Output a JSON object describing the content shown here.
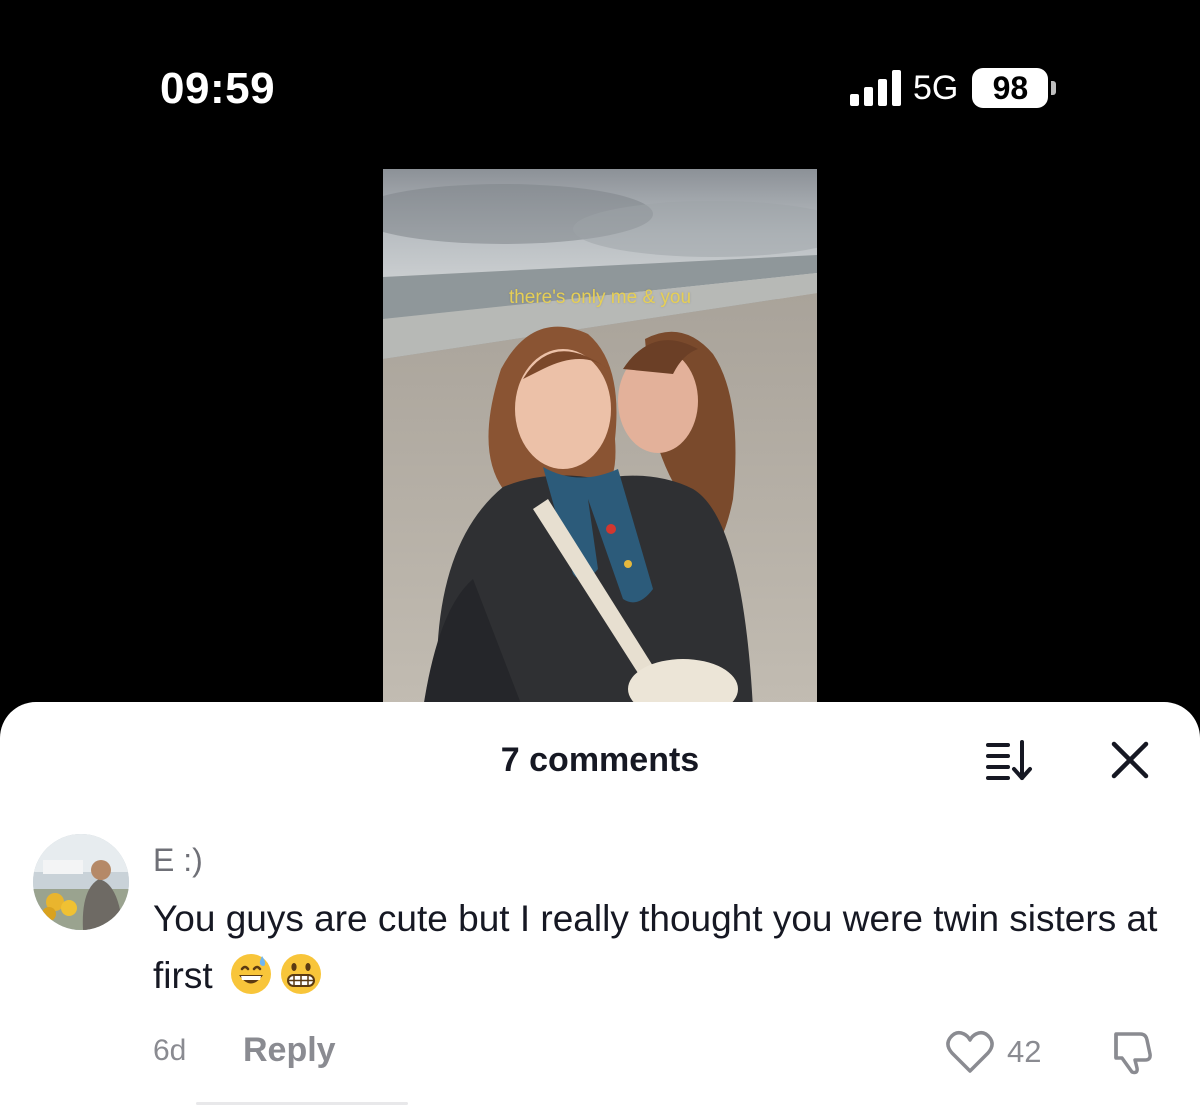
{
  "status_bar": {
    "time": "09:59",
    "network": "5G",
    "battery": "98"
  },
  "video": {
    "caption": "there's only me & you"
  },
  "comments_sheet": {
    "title": "7 comments",
    "comment": {
      "username": "E :)",
      "text": "You guys are cute but I really thought you were twin sisters at first",
      "emojis": [
        "grinning-sweat-emoji",
        "grimacing-emoji"
      ],
      "time": "6d",
      "reply_label": "Reply",
      "like_count": "42"
    }
  },
  "colors": {
    "caption": "#e6cf55",
    "text_primary": "#161823",
    "text_secondary": "#8a8b91",
    "emoji_yellow": "#f8c53a"
  }
}
